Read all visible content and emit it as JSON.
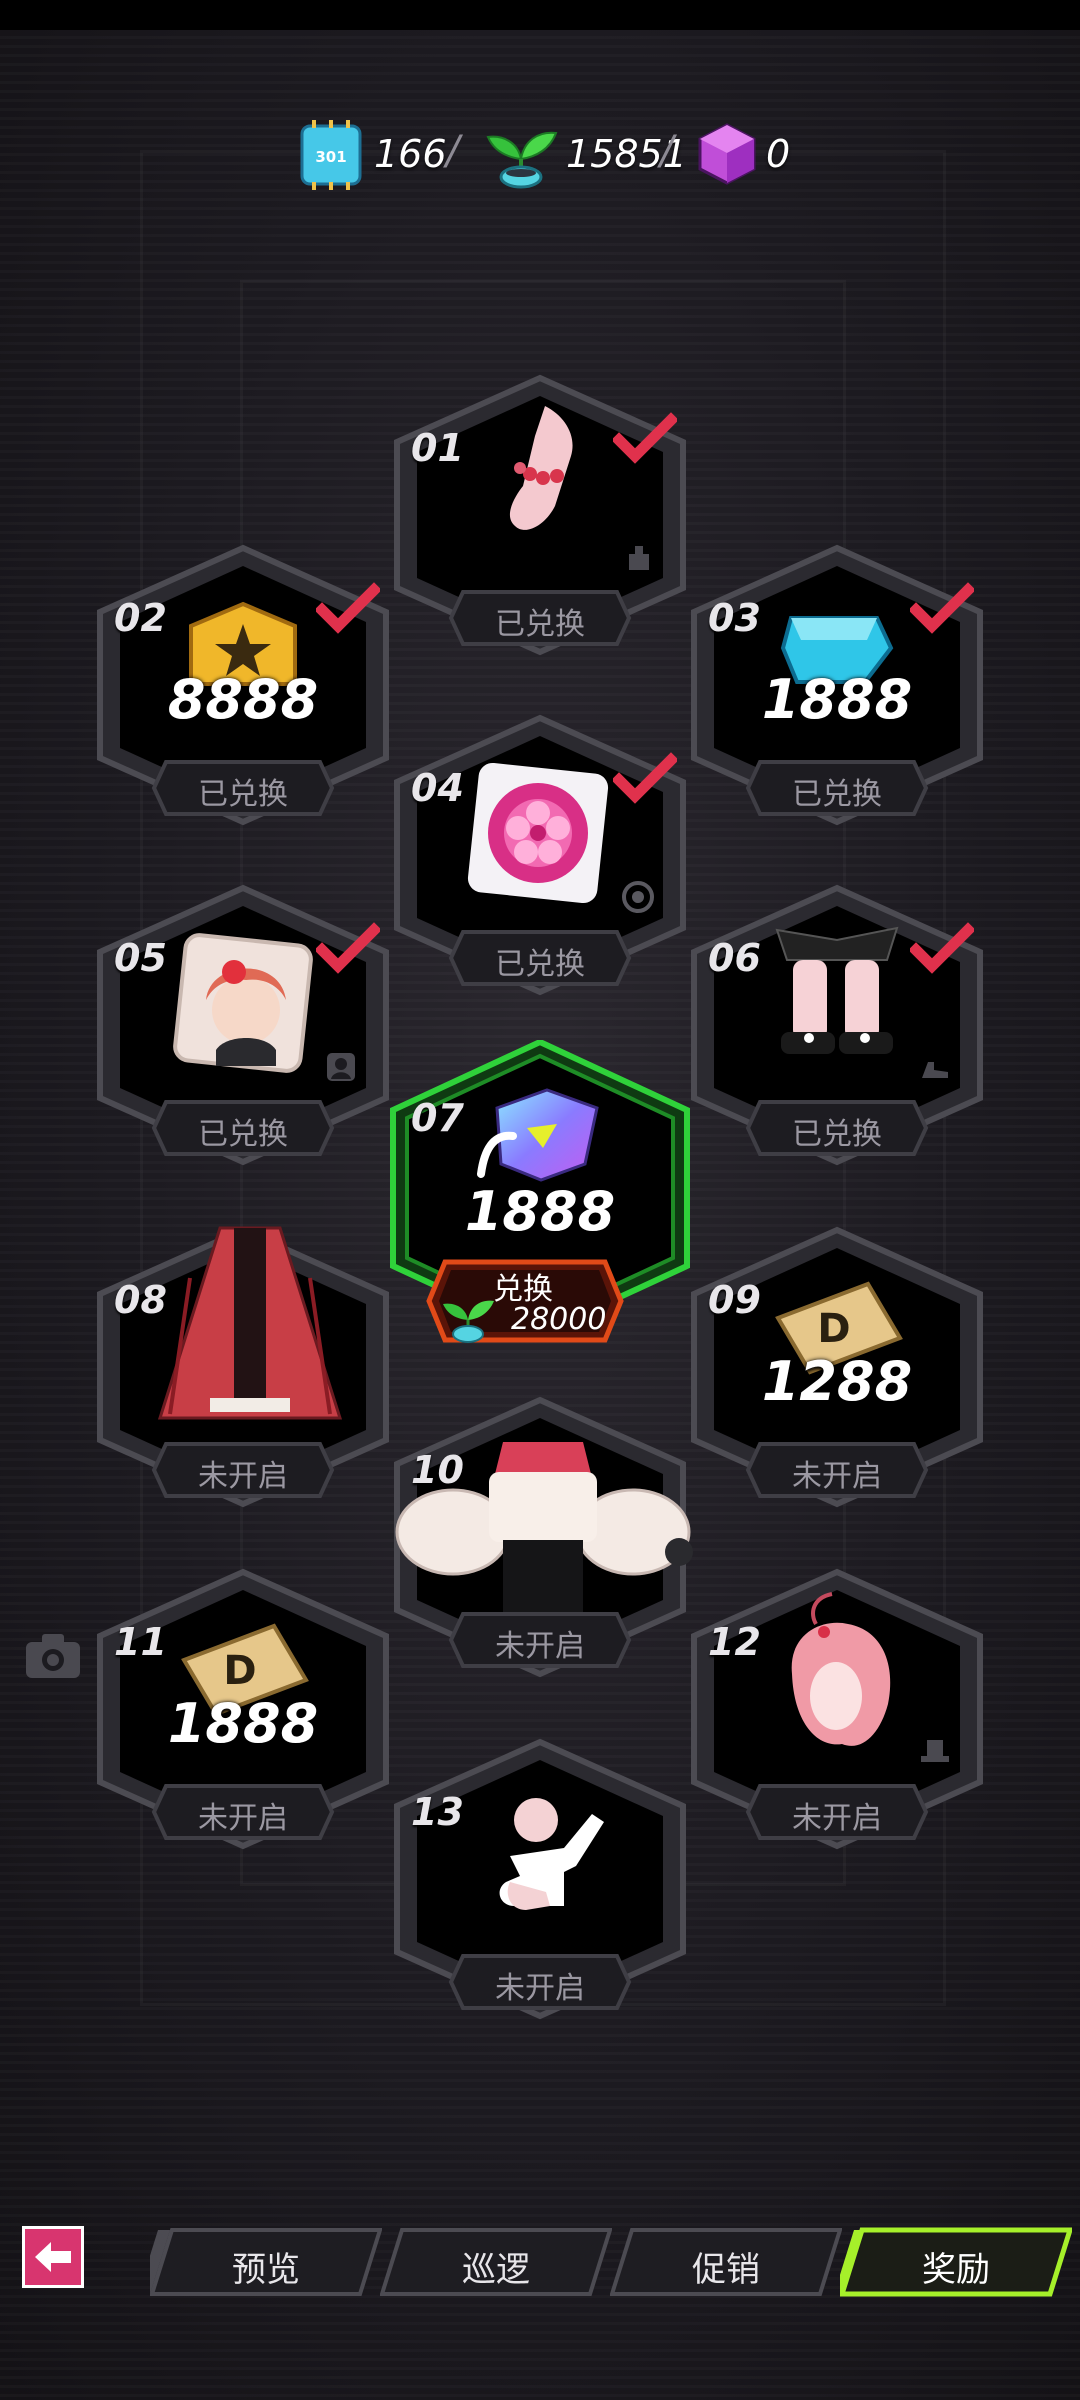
{
  "currencies": [
    {
      "name": "chip-token",
      "value": "166",
      "icon": "chip-301-icon"
    },
    {
      "name": "sprout-token",
      "value": "15851",
      "icon": "sprout-pot-icon"
    },
    {
      "name": "cube-token",
      "value": "0",
      "icon": "purple-cube-icon"
    }
  ],
  "rewards": [
    {
      "num": "01",
      "status": "已兑换",
      "claimed": true,
      "item": "bracelet-icon"
    },
    {
      "num": "02",
      "amount": "8888",
      "status": "已兑换",
      "claimed": true,
      "item": "gold-star-badge-icon"
    },
    {
      "num": "03",
      "amount": "1888",
      "status": "已兑换",
      "claimed": true,
      "item": "blue-gem-icon"
    },
    {
      "num": "04",
      "status": "已兑换",
      "claimed": true,
      "item": "flower-emblem-icon"
    },
    {
      "num": "05",
      "status": "已兑换",
      "claimed": true,
      "item": "portrait-avatar-icon"
    },
    {
      "num": "06",
      "status": "已兑换",
      "claimed": true,
      "item": "shoes-icon"
    },
    {
      "num": "07",
      "amount": "1888",
      "status": "兑换",
      "cost": "28000",
      "claimed": false,
      "item": "holo-gem-icon"
    },
    {
      "num": "08",
      "status": "未开启",
      "claimed": false,
      "item": "red-cape-icon"
    },
    {
      "num": "09",
      "amount": "1288",
      "status": "未开启",
      "claimed": false,
      "item": "gold-ticket-icon"
    },
    {
      "num": "10",
      "status": "未开启",
      "claimed": false,
      "item": "blouse-icon"
    },
    {
      "num": "11",
      "amount": "1888",
      "status": "未开启",
      "claimed": false,
      "item": "gold-ticket-icon"
    },
    {
      "num": "12",
      "status": "未开启",
      "claimed": false,
      "item": "pink-hair-icon"
    },
    {
      "num": "13",
      "status": "未开启",
      "claimed": false,
      "item": "pose-icon"
    }
  ],
  "nav": {
    "tabs": [
      "预览",
      "巡逻",
      "促销",
      "奖励"
    ],
    "active": "奖励"
  },
  "colors": {
    "check": "#e0314c",
    "active_tab": "#a6f02a",
    "featured_border": "#2fd23a",
    "exchange_button": "#e14a18",
    "back_button": "#d8356f"
  }
}
